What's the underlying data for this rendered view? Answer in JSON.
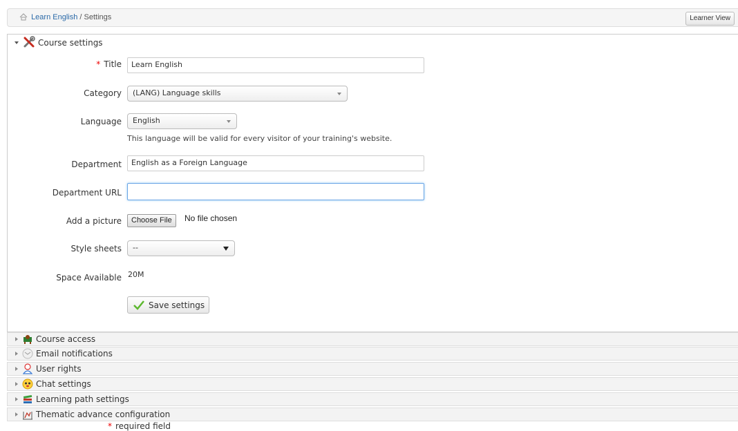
{
  "breadcrumb": {
    "home": "Learn English",
    "separator": "/",
    "current": "Settings"
  },
  "learner_view": "Learner View",
  "panel": {
    "title": "Course settings",
    "fields": {
      "title": {
        "label": "Title",
        "required_mark": "*",
        "value": "Learn English"
      },
      "category": {
        "label": "Category",
        "value": "(LANG) Language skills"
      },
      "language": {
        "label": "Language",
        "value": "English",
        "help": "This language will be valid for every visitor of your training's website."
      },
      "department": {
        "label": "Department",
        "value": "English as a Foreign Language"
      },
      "department_url": {
        "label": "Department URL",
        "value": ""
      },
      "picture": {
        "label": "Add a picture",
        "button": "Choose File",
        "status": "No file chosen"
      },
      "style_sheets": {
        "label": "Style sheets",
        "value": "--"
      },
      "space": {
        "label": "Space Available",
        "value": "20M"
      }
    },
    "save": "Save settings"
  },
  "sections": [
    {
      "label": "Course access",
      "icon": "course-access-icon"
    },
    {
      "label": "Email notifications",
      "icon": "email-icon"
    },
    {
      "label": "User rights",
      "icon": "user-icon"
    },
    {
      "label": "Chat settings",
      "icon": "chat-icon"
    },
    {
      "label": "Learning path settings",
      "icon": "books-icon"
    },
    {
      "label": "Thematic advance configuration",
      "icon": "chart-icon"
    }
  ],
  "required_note": {
    "mark": "*",
    "text": "required field"
  },
  "colors": {
    "link": "#2b6aa8",
    "required": "#ee0000",
    "focus": "#6aa5e6"
  }
}
